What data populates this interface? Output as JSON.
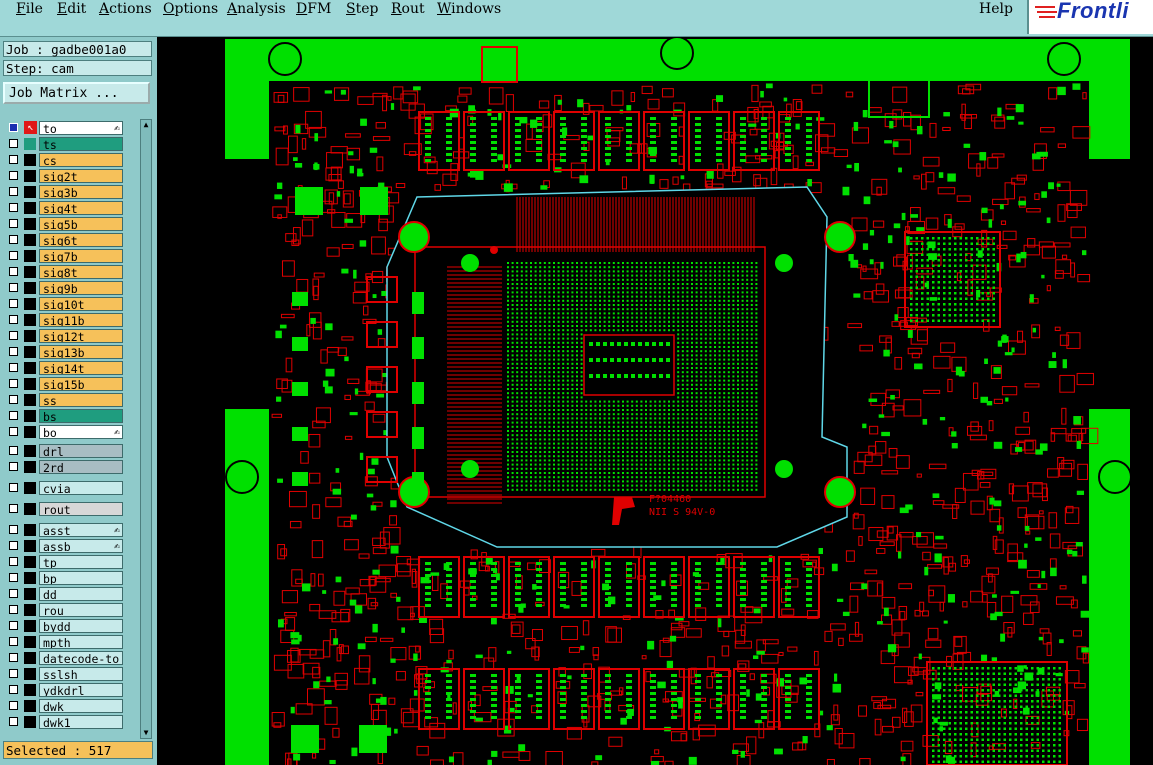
{
  "menu": {
    "items": [
      "File",
      "Edit",
      "Actions",
      "Options",
      "Analysis",
      "DFM",
      "Step",
      "Rout",
      "Windows"
    ],
    "help": "Help"
  },
  "logo": {
    "text": "Frontli"
  },
  "job": {
    "job_label": "Job : gadbe001a0",
    "step_label": "Step: cam",
    "job_matrix_button": "Job Matrix ..."
  },
  "layers": [
    {
      "name": "to",
      "style": "white",
      "edit": true
    },
    {
      "name": "ts",
      "style": "green"
    },
    {
      "name": "cs",
      "style": "yellow"
    },
    {
      "name": "sig2t",
      "style": "yellow"
    },
    {
      "name": "sig3b",
      "style": "yellow"
    },
    {
      "name": "sig4t",
      "style": "yellow"
    },
    {
      "name": "sig5b",
      "style": "yellow"
    },
    {
      "name": "sig6t",
      "style": "yellow"
    },
    {
      "name": "sig7b",
      "style": "yellow"
    },
    {
      "name": "sig8t",
      "style": "yellow"
    },
    {
      "name": "sig9b",
      "style": "yellow"
    },
    {
      "name": "sig10t",
      "style": "yellow"
    },
    {
      "name": "sig11b",
      "style": "yellow"
    },
    {
      "name": "sig12t",
      "style": "yellow"
    },
    {
      "name": "sig13b",
      "style": "yellow"
    },
    {
      "name": "sig14t",
      "style": "yellow"
    },
    {
      "name": "sig15b",
      "style": "yellow"
    },
    {
      "name": "ss",
      "style": "yellow"
    },
    {
      "name": "bs",
      "style": "green"
    },
    {
      "name": "bo",
      "style": "white",
      "edit": true
    },
    {
      "name": "drl",
      "style": "grey"
    },
    {
      "name": "2rd",
      "style": "grey"
    },
    {
      "name": "cvia",
      "style": "light"
    },
    {
      "name": "rout",
      "style": "rout"
    },
    {
      "name": "asst",
      "style": "cyan",
      "edit": true
    },
    {
      "name": "assb",
      "style": "cyan",
      "edit": true
    },
    {
      "name": "tp",
      "style": "cyan"
    },
    {
      "name": "bp",
      "style": "cyan"
    },
    {
      "name": "dd",
      "style": "cyan"
    },
    {
      "name": "rou",
      "style": "cyan"
    },
    {
      "name": "bydd",
      "style": "cyan"
    },
    {
      "name": "mpth",
      "style": "cyan"
    },
    {
      "name": "datecode-to",
      "style": "cyan"
    },
    {
      "name": "sslsh",
      "style": "cyan"
    },
    {
      "name": "ydkdrl",
      "style": "cyan"
    },
    {
      "name": "dwk",
      "style": "cyan"
    },
    {
      "name": "dwk1",
      "style": "cyan"
    }
  ],
  "status": {
    "selected": "Selected : 517"
  },
  "board": {
    "marking_line1": "F?04460",
    "marking_line2": "NII S 94V-0"
  },
  "colors": {
    "menu_bg": "#9fd8d8",
    "board_green": "#00e000",
    "board_red": "#e00000",
    "outline_cyan": "#5fd7e8",
    "layer_yellow": "#f6c15a",
    "layer_green": "#1f9d7f"
  }
}
